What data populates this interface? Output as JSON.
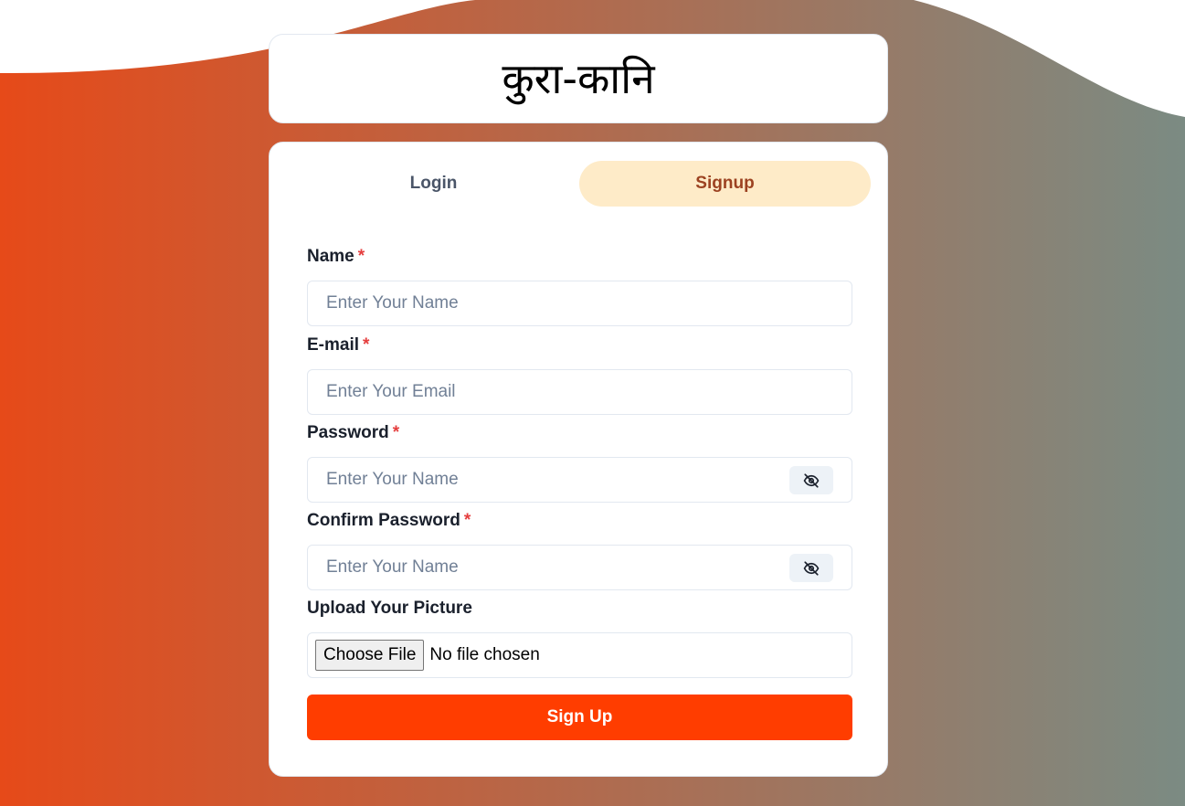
{
  "app": {
    "title": "कुरा-कानि"
  },
  "theme": {
    "gradient_start": "#e64a19",
    "gradient_end": "#7b8b83",
    "submit_color": "#ff3d00",
    "active_tab_bg": "#feebc8",
    "active_tab_text": "#9c4221",
    "required_color": "#e53e3e"
  },
  "tabs": [
    {
      "label": "Login",
      "active": false
    },
    {
      "label": "Signup",
      "active": true
    }
  ],
  "form": {
    "required_marker": "*",
    "name": {
      "label": "Name",
      "placeholder": "Enter Your Name",
      "value": ""
    },
    "email": {
      "label": "E-mail",
      "placeholder": "Enter Your Email",
      "value": ""
    },
    "password": {
      "label": "Password",
      "placeholder": "Enter Your Name",
      "value": "",
      "toggle_icon": "eye-off-icon"
    },
    "confirm_password": {
      "label": "Confirm Password",
      "placeholder": "Enter Your Name",
      "value": "",
      "toggle_icon": "eye-off-icon"
    },
    "picture": {
      "label": "Upload Your Picture",
      "button_label": "Choose File",
      "status": "No file chosen"
    },
    "submit_label": "Sign Up"
  }
}
